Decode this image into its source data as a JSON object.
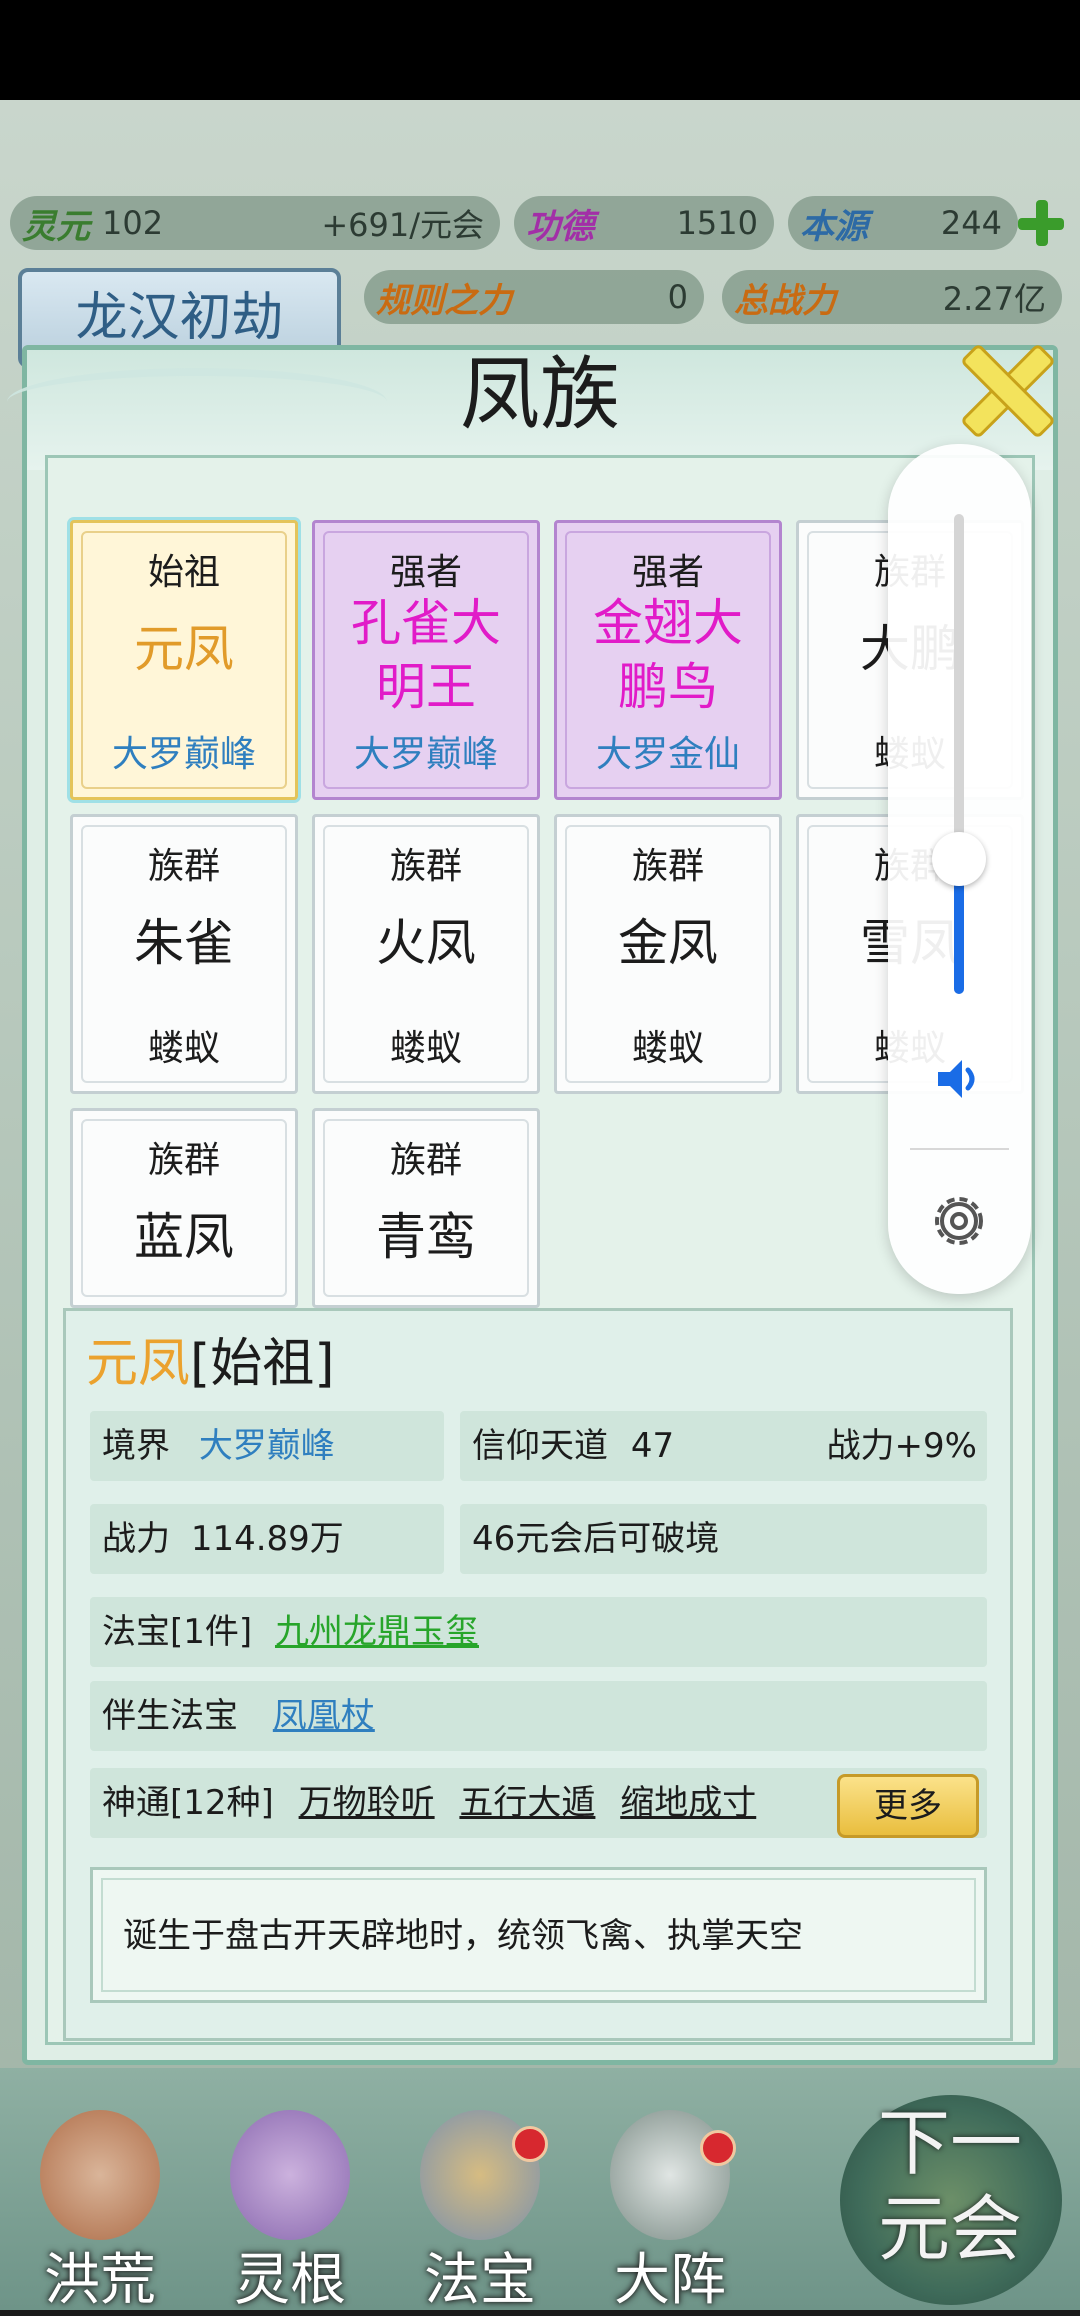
{
  "resources": {
    "lingyuan": {
      "label": "灵元",
      "value": "102",
      "rate": "+691/元会"
    },
    "gongde": {
      "label": "功德",
      "value": "1510"
    },
    "benyuan": {
      "label": "本源",
      "value": "244"
    },
    "guize": {
      "label": "规则之力",
      "value": "0"
    },
    "zhanli_total": {
      "label": "总战力",
      "value": "2.27亿"
    }
  },
  "era_title": "龙汉初劫",
  "modal": {
    "title": "凤族",
    "cards": [
      {
        "rank": "始祖",
        "name": "元凤",
        "realm": "大罗巅峰",
        "style": "gold"
      },
      {
        "rank": "强者",
        "name": "孔雀大明王",
        "realm": "大罗巅峰",
        "style": "purple"
      },
      {
        "rank": "强者",
        "name": "金翅大鹏鸟",
        "realm": "大罗金仙",
        "style": "purple"
      },
      {
        "rank": "族群",
        "name": "大鹏",
        "realm": "蝼蚁",
        "style": "plain"
      },
      {
        "rank": "族群",
        "name": "朱雀",
        "realm": "蝼蚁",
        "style": "plain"
      },
      {
        "rank": "族群",
        "name": "火凤",
        "realm": "蝼蚁",
        "style": "plain"
      },
      {
        "rank": "族群",
        "name": "金凤",
        "realm": "蝼蚁",
        "style": "plain"
      },
      {
        "rank": "族群",
        "name": "雪凤",
        "realm": "蝼蚁",
        "style": "plain"
      },
      {
        "rank": "族群",
        "name": "蓝凤",
        "realm": "",
        "style": "plain"
      },
      {
        "rank": "族群",
        "name": "青鸾",
        "realm": "",
        "style": "plain"
      }
    ],
    "detail": {
      "name": "元凤",
      "rank_tag": "[始祖]",
      "realm_label": "境界",
      "realm_value": "大罗巅峰",
      "faith_label": "信仰天道",
      "faith_value": "47",
      "faith_bonus": "战力+9%",
      "power_label": "战力",
      "power_value": "114.89万",
      "breakthrough": "46元会后可破境",
      "treasure_label": "法宝[1件]",
      "treasure_value": "九州龙鼎玉玺",
      "companion_label": "伴生法宝",
      "companion_value": "凤凰杖",
      "skills_label": "神通[12种]",
      "skills": [
        "万物聆听",
        "五行大遁",
        "缩地成寸"
      ],
      "more_button": "更多",
      "description": "诞生于盘古开天辟地时，统领飞禽、执掌天空"
    }
  },
  "volume_panel": {
    "level": 0.35
  },
  "bottom_nav": {
    "items": [
      "洪荒",
      "灵根",
      "法宝",
      "大阵"
    ],
    "next_button": [
      "下一",
      "元会"
    ]
  },
  "colors": {
    "gold_card": "#fff6d8",
    "purple_card": "#e6d0f1",
    "accent_blue": "#2f7fbf",
    "accent_green": "#27a52a",
    "magenta": "#e11bc8",
    "orange": "#e19b2a"
  }
}
